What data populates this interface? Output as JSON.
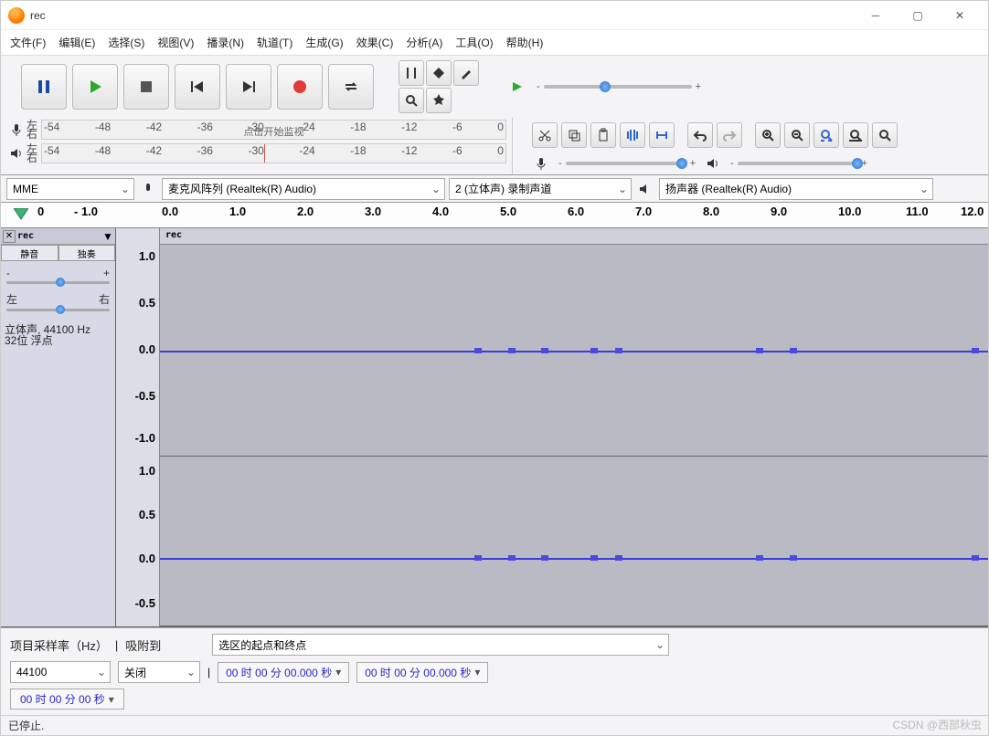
{
  "window": {
    "title": "rec"
  },
  "menu": [
    "文件(F)",
    "编辑(E)",
    "选择(S)",
    "视图(V)",
    "播录(N)",
    "轨道(T)",
    "生成(G)",
    "效果(C)",
    "分析(A)",
    "工具(O)",
    "帮助(H)"
  ],
  "meters": {
    "left": "左",
    "right": "右",
    "click_text": "点击开始监视",
    "ticks": [
      "-54",
      "-48",
      "-42",
      "-36",
      "-30",
      "-24",
      "-18",
      "-12",
      "-6",
      "0"
    ]
  },
  "device": {
    "host": "MME",
    "input": "麦克风阵列 (Realtek(R) Audio)",
    "channels": "2 (立体声) 录制声道",
    "output": "扬声器 (Realtek(R) Audio)"
  },
  "timeline": {
    "labels": [
      "0",
      "- 1.0",
      "0.0",
      "1.0",
      "2.0",
      "3.0",
      "4.0",
      "5.0",
      "6.0",
      "7.0",
      "8.0",
      "9.0",
      "10.0",
      "11.0",
      "12.0"
    ]
  },
  "track": {
    "name": "rec",
    "mute": "静音",
    "solo": "独奏",
    "gain_minus": "-",
    "gain_plus": "+",
    "pan_left": "左",
    "pan_right": "右",
    "info1": "立体声, 44100 Hz",
    "info2": "32位 浮点",
    "vaxis": [
      "1.0",
      "0.5",
      "0.0",
      "-0.5",
      "-1.0"
    ],
    "clip": "rec"
  },
  "bottom": {
    "rate_label": "项目采样率（Hz）",
    "snap_label": "吸附到",
    "rate": "44100",
    "snap": "关闭",
    "sel_label": "选区的起点和终点",
    "time1": "00 时 00 分 00.000 秒",
    "time2": "00 时 00 分 00.000 秒",
    "pos": "00 时 00 分 00 秒"
  },
  "status": "已停止.",
  "watermark": "CSDN @西部秋虫"
}
